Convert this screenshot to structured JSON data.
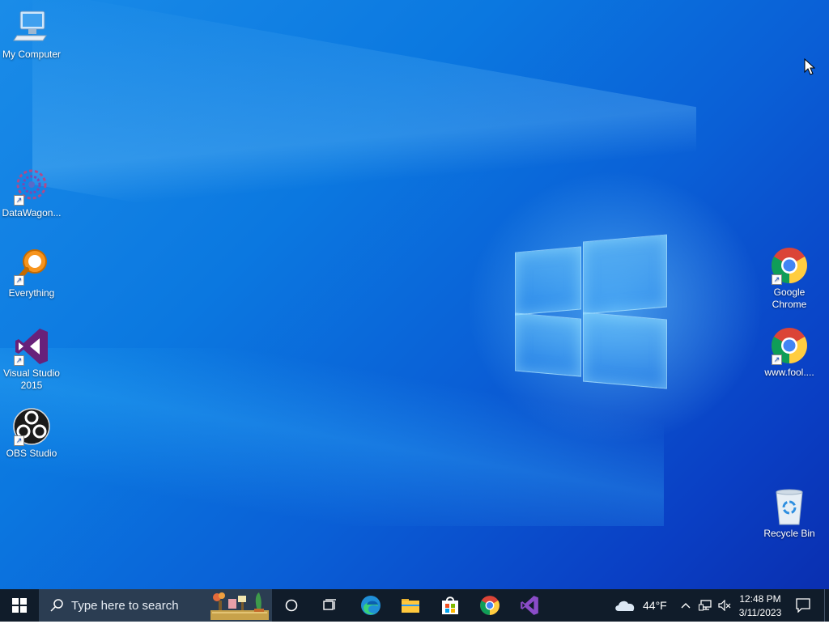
{
  "desktop": {
    "icons": [
      {
        "id": "my-computer",
        "label": "My Computer"
      },
      {
        "id": "datawagon",
        "label": "DataWagon..."
      },
      {
        "id": "everything",
        "label": "Everything"
      },
      {
        "id": "visual-studio",
        "label": "Visual Studio 2015"
      },
      {
        "id": "obs-studio",
        "label": "OBS Studio"
      },
      {
        "id": "google-chrome",
        "label": "Google Chrome"
      },
      {
        "id": "www-fool",
        "label": "www.fool...."
      },
      {
        "id": "recycle-bin",
        "label": "Recycle Bin"
      }
    ]
  },
  "taskbar": {
    "search_placeholder": "Type here to search",
    "pinned": [
      "start-icon",
      "cortana-icon",
      "task-view-icon",
      "edge-icon",
      "file-explorer-icon",
      "store-icon",
      "chrome-icon",
      "visual-studio-icon"
    ],
    "weather_temp": "44°F",
    "clock_time": "12:48 PM",
    "clock_date": "3/11/2023"
  },
  "colors": {
    "taskbar_bg": "#101c2a",
    "desktop_blue": "#0b78e0"
  }
}
